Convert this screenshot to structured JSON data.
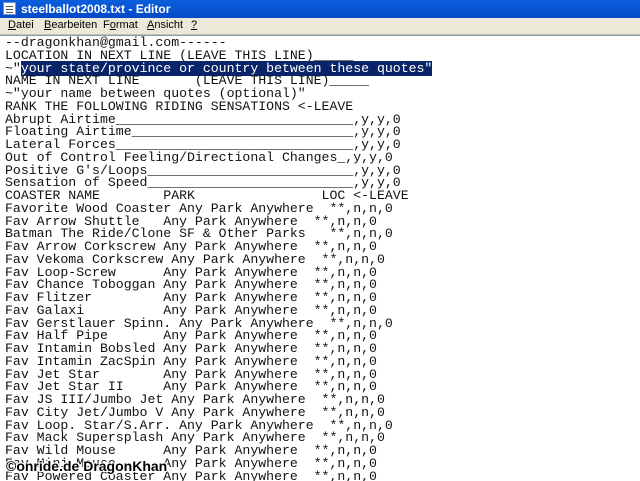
{
  "window": {
    "title": "steelballot2008.txt - Editor",
    "icon": "notepad-icon"
  },
  "menu": [
    {
      "label": "Datei",
      "accel": "D",
      "rest": "atei"
    },
    {
      "label": "Bearbeiten",
      "accel": "B",
      "rest": "earbeiten"
    },
    {
      "label": "Format",
      "accel": "o",
      "pre": "F",
      "rest": "rmat"
    },
    {
      "label": "Ansicht",
      "accel": "A",
      "rest": "nsicht"
    },
    {
      "label": "?",
      "accel": "?",
      "rest": ""
    }
  ],
  "editor": {
    "lines": [
      "--dragonkhan@gmail.com------",
      "LOCATION IN NEXT LINE (LEAVE THIS LINE)_____",
      "~\"your state/province or country between these quotes\"",
      "NAME IN NEXT LINE       (LEAVE THIS LINE)_____",
      "~\"your name between quotes (optional)\"",
      "RANK THE FOLLOWING RIDING SENSATIONS <-LEAVE",
      "Abrupt Airtime______________________________,y,y,0",
      "Floating Airtime____________________________,y,y,0",
      "Lateral Forces______________________________,y,y,0",
      "Out of Control Feeling/Directional Changes_,y,y,0",
      "Positive G's/Loops__________________________,y,y,0",
      "Sensation of Speed__________________________,y,y,0",
      "COASTER NAME        PARK                LOC <-LEAVE",
      "Favorite Wood Coaster Any Park Anywhere  **,n,n,0",
      "Fav Arrow Shuttle   Any Park Anywhere  **,n,n,0",
      "Batman The Ride/Clone SF & Other Parks   **,n,n,0",
      "Fav Arrow Corkscrew Any Park Anywhere  **,n,n,0",
      "Fav Vekoma Corkscrew Any Park Anywhere  **,n,n,0",
      "Fav Loop-Screw      Any Park Anywhere  **,n,n,0",
      "Fav Chance Toboggan Any Park Anywhere  **,n,n,0",
      "Fav Flitzer         Any Park Anywhere  **,n,n,0",
      "Fav Galaxi          Any Park Anywhere  **,n,n,0",
      "Fav Gerstlauer Spinn. Any Park Anywhere  **,n,n,0",
      "Fav Half Pipe       Any Park Anywhere  **,n,n,0",
      "Fav Intamin Bobsled Any Park Anywhere  **,n,n,0",
      "Fav Intamin ZacSpin Any Park Anywhere  **,n,n,0",
      "Fav Jet Star        Any Park Anywhere  **,n,n,0",
      "Fav Jet Star II     Any Park Anywhere  **,n,n,0",
      "Fav JS III/Jumbo Jet Any Park Anywhere  **,n,n,0",
      "Fav City Jet/Jumbo V Any Park Anywhere  **,n,n,0",
      "Fav Loop. Star/S.Arr. Any Park Anywhere  **,n,n,0",
      "Fav Mack Supersplash Any Park Anywhere  **,n,n,0",
      "Fav Wild Mouse      Any Park Anywhere  **,n,n,0",
      "Fav Mini Mouse      Any Park Anywhere  **,n,n,0",
      "Fav Powered Coaster Any Park Anywhere  **,n,n,0"
    ],
    "selection": {
      "line": 2,
      "text": "your state/province or country between these quotes\""
    }
  },
  "watermark": "©onride.de  DragonKhan"
}
